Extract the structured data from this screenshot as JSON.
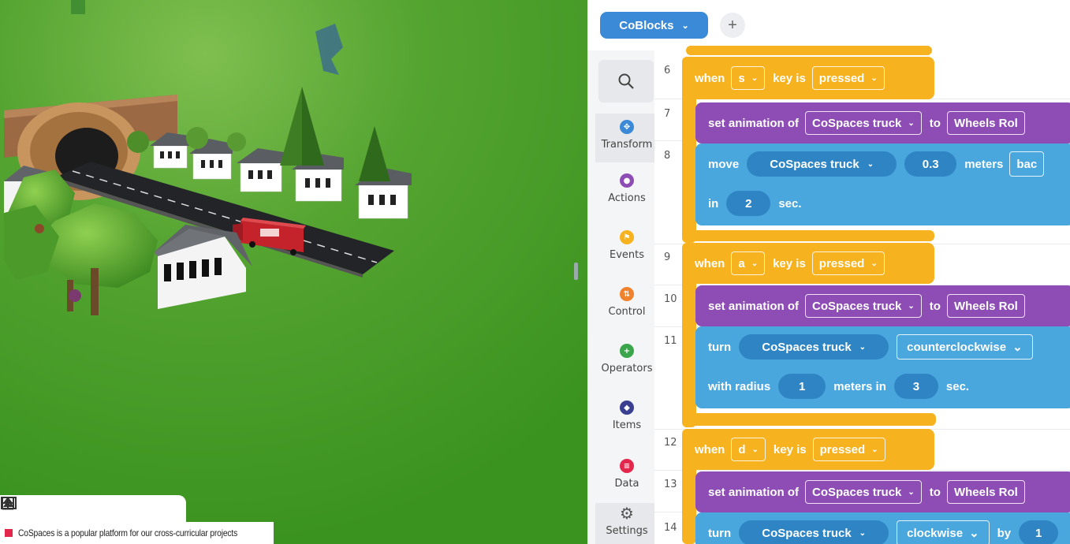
{
  "caption": {
    "text": "CoSpaces is a popular platform for our cross-curricular projects",
    "marker_color": "#e3264c"
  },
  "scene": {
    "toolbar": [
      {
        "icon": "fit-view-icon"
      },
      {
        "icon": "upload-icon"
      },
      {
        "icon": "image-icon"
      }
    ],
    "truck_logo": "cospaces"
  },
  "editor": {
    "tab": {
      "label": "CoBlocks"
    },
    "add_label": "+",
    "palette": [
      {
        "label": "Transform",
        "icon": "transform-icon",
        "color": "#3b8ad8"
      },
      {
        "label": "Actions",
        "icon": "actions-icon",
        "color": "#8e4db5"
      },
      {
        "label": "Events",
        "icon": "events-icon",
        "color": "#f7b21f"
      },
      {
        "label": "Control",
        "icon": "control-icon",
        "color": "#f0812d"
      },
      {
        "label": "Operators",
        "icon": "operators-icon",
        "color": "#3aa54a"
      },
      {
        "label": "Items",
        "icon": "items-icon",
        "color": "#3a3f8f"
      },
      {
        "label": "Data",
        "icon": "data-icon",
        "color": "#e3264c"
      },
      {
        "label": "Settings",
        "icon": "settings-icon",
        "color": "#555555"
      }
    ],
    "line_numbers": [
      "6",
      "7",
      "8",
      "9",
      "10",
      "11",
      "12",
      "13",
      "14"
    ],
    "blocks": {
      "when": "when",
      "key_is": "key is",
      "pressed": "pressed",
      "set_animation_of": "set animation of",
      "to": "to",
      "truck": "CoSpaces truck",
      "anim": "Wheels Rol",
      "move": "move",
      "meters": "meters",
      "back": "bac",
      "in": "in",
      "sec": "sec.",
      "turn": "turn",
      "with_radius": "with radius",
      "meters_in": "meters in",
      "by": "by",
      "by_val": "1",
      "keys": [
        "s",
        "a",
        "d"
      ],
      "move_dist": "0.3",
      "move_time": "2",
      "turn1_dir": "counterclockwise",
      "radius": "1",
      "turn1_time": "3",
      "turn2_dir": "clockwise"
    }
  }
}
